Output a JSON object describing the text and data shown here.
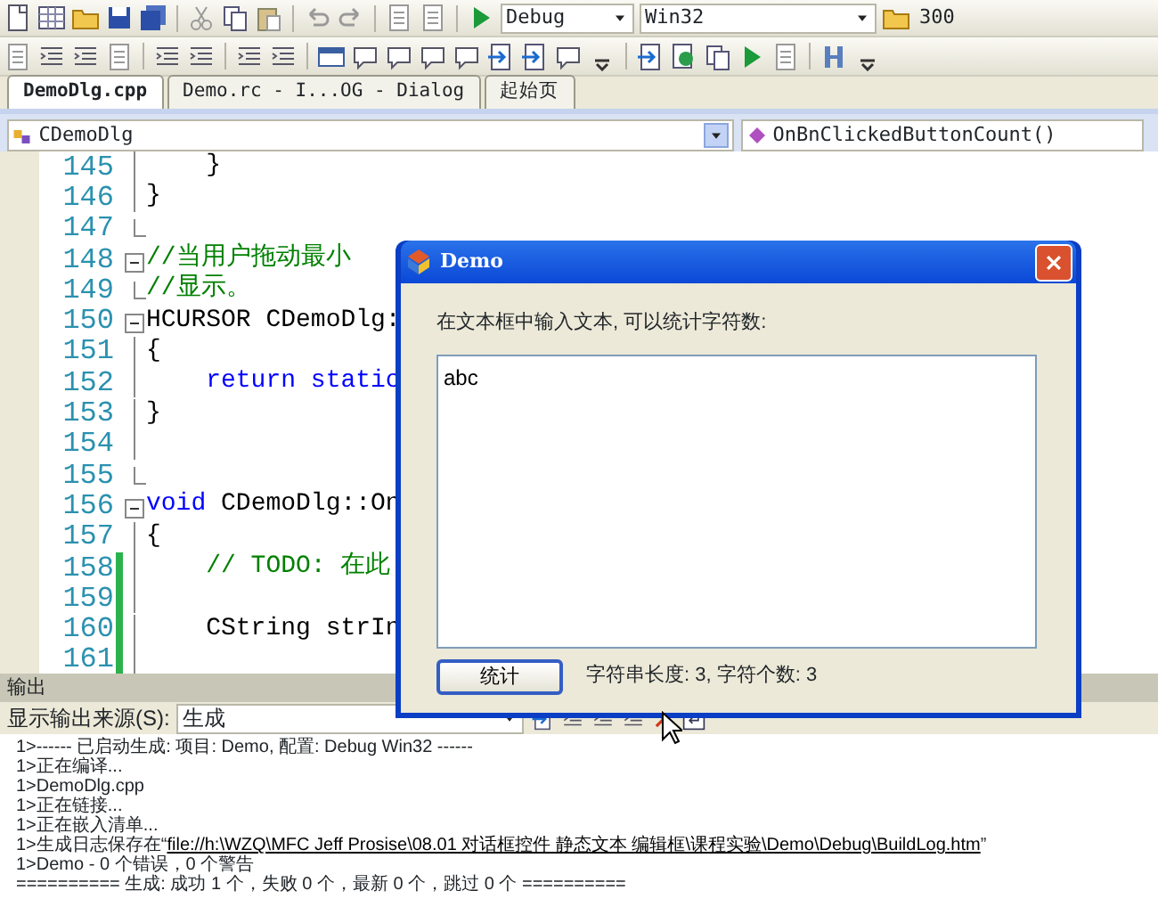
{
  "toolbar": {
    "configuration": "Debug",
    "platform": "Win32",
    "find_value": "300"
  },
  "editor_tabs": [
    {
      "label": "DemoDlg.cpp",
      "selected": true
    },
    {
      "label": "Demo.rc - I...OG - Dialog",
      "selected": false
    },
    {
      "label": "起始页",
      "selected": false
    }
  ],
  "class_combo": "CDemoDlg",
  "member_combo": "OnBnClickedButtonCount()",
  "code_lines": [
    {
      "number": "145",
      "kind": "fold_line",
      "changed": false,
      "segments": [
        {
          "text": "    }",
          "kind": "plain"
        }
      ]
    },
    {
      "number": "146",
      "kind": "fold_line",
      "changed": false,
      "segments": [
        {
          "text": "}",
          "kind": "plain"
        }
      ]
    },
    {
      "number": "147",
      "kind": "fold_end",
      "changed": false
    },
    {
      "number": "148",
      "kind": "fold_start",
      "changed": false,
      "segments": [
        {
          "text": "//当用户拖动最小",
          "kind": "comment"
        }
      ]
    },
    {
      "number": "149",
      "kind": "fold_end",
      "changed": false,
      "segments": [
        {
          "text": "//显示。",
          "kind": "comment"
        }
      ]
    },
    {
      "number": "150",
      "kind": "fold_start",
      "changed": false,
      "segments": [
        {
          "text": "HCURSOR CDemoDlg:",
          "kind": "plain"
        }
      ]
    },
    {
      "number": "151",
      "kind": "fold_line",
      "changed": false,
      "segments": [
        {
          "text": "{",
          "kind": "plain"
        }
      ]
    },
    {
      "number": "152",
      "kind": "fold_line",
      "changed": false,
      "segments": [
        {
          "text": "    return static",
          "kind": "keyword"
        }
      ]
    },
    {
      "number": "153",
      "kind": "fold_line",
      "changed": false,
      "segments": [
        {
          "text": "}",
          "kind": "plain"
        }
      ]
    },
    {
      "number": "154",
      "kind": "fold_line",
      "changed": false
    },
    {
      "number": "155",
      "kind": "fold_end",
      "changed": false
    },
    {
      "number": "156",
      "kind": "fold_start",
      "changed": false,
      "segments": [
        {
          "text": "void",
          "kind": "keyword"
        },
        {
          "text": " CDemoDlg::On",
          "kind": "plain"
        }
      ]
    },
    {
      "number": "157",
      "kind": "fold_line",
      "changed": false,
      "segments": [
        {
          "text": "{",
          "kind": "plain"
        }
      ]
    },
    {
      "number": "158",
      "kind": "fold_line",
      "changed": true,
      "segments": [
        {
          "text": "    // TODO: 在此",
          "kind": "comment"
        }
      ]
    },
    {
      "number": "159",
      "kind": "fold_line",
      "changed": true
    },
    {
      "number": "160",
      "kind": "fold_line",
      "changed": true,
      "segments": [
        {
          "text": "    CString strIn",
          "kind": "plain"
        }
      ]
    },
    {
      "number": "161",
      "kind": "fold_line",
      "changed": true
    }
  ],
  "dialog": {
    "title": "Demo",
    "prompt": "在文本框中输入文本, 可以统计字符数:",
    "text_value": "abc",
    "button": "统计",
    "result": "字符串长度: 3, 字符个数: 3"
  },
  "output": {
    "title": "输出",
    "source_label": "显示输出来源(S):",
    "source_value": "生成",
    "lines": [
      {
        "text": "1>------ 已启动生成: 项目: Demo, 配置: Debug Win32 ------"
      },
      {
        "text": "1>正在编译..."
      },
      {
        "text": "1>DemoDlg.cpp"
      },
      {
        "text": "1>正在链接..."
      },
      {
        "text": "1>正在嵌入清单..."
      },
      {
        "text": "1>生成日志保存在“",
        "link": "file://h:\\WZQ\\MFC Jeff Prosise\\08.01 对话框控件 静态文本 编辑框\\课程实验\\Demo\\Debug\\BuildLog.htm",
        "after": "”"
      },
      {
        "text": "1>Demo - 0 个错误，0 个警告"
      },
      {
        "text": "========== 生成: 成功 1 个，失败 0 个，最新 0 个，跳过 0 个 =========="
      }
    ]
  }
}
